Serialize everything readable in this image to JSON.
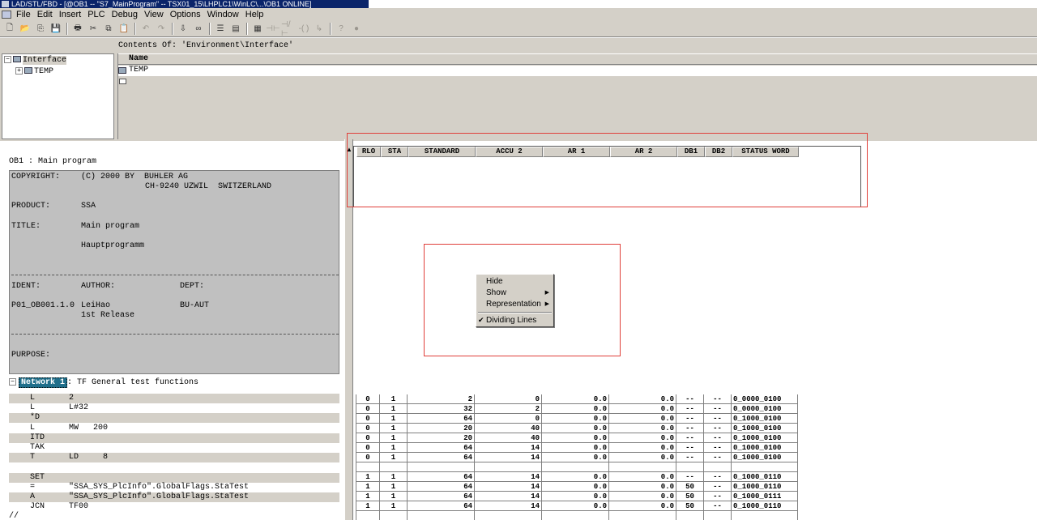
{
  "window": {
    "title": "LAD/STL/FBD  - [@OB1 -- \"S7_MainProgram\" -- TSX01_15\\LHPLC1\\WinLC\\...\\OB1  ONLINE]"
  },
  "menu": [
    "File",
    "Edit",
    "Insert",
    "PLC",
    "Debug",
    "View",
    "Options",
    "Window",
    "Help"
  ],
  "toolbar_icons": [
    "new-icon",
    "open-icon",
    "accessible-nodes-icon",
    "save-icon",
    "print-icon",
    "cut-icon",
    "copy-icon",
    "paste-icon",
    "undo-icon",
    "redo-icon",
    "load-icon",
    "monitor-icon",
    "overview-icon",
    "program-elements-icon",
    "details-icon",
    "contact-no-icon",
    "contact-nc-icon",
    "coil-icon",
    "branch-icon",
    "help-icon",
    "breakpoint-icon"
  ],
  "interface": {
    "contents_of": "Contents Of: 'Environment\\Interface'",
    "tree": [
      {
        "label": "Interface"
      },
      {
        "label": "TEMP"
      }
    ],
    "column_name": "Name",
    "rows": [
      "TEMP"
    ]
  },
  "block": {
    "title": "OB1 : Main program",
    "comment": {
      "copyright_label": "COPYRIGHT:",
      "copyright_line1": "(C) 2000 BY  BUHLER AG",
      "copyright_line2": "CH-9240 UZWIL  SWITZERLAND",
      "product_label": "PRODUCT:",
      "product": "SSA",
      "title_label": "TITLE:",
      "title1": "Main program",
      "title2": "Hauptprogramm",
      "ident_label": "IDENT:",
      "author_label": "AUTHOR:",
      "dept_label": "DEPT:",
      "ident": "P01_OB001.1.0",
      "author": "LeiHao",
      "release": "1st Release",
      "dept": "BU-AUT",
      "purpose_label": "PURPOSE:"
    },
    "network": {
      "badge": "Network 1",
      "title": ": TF General test functions"
    },
    "stl": [
      {
        "op": "L",
        "arg": "2"
      },
      {
        "op": "L",
        "arg": "L#32"
      },
      {
        "op": "*D",
        "arg": ""
      },
      {
        "op": "L",
        "arg": "MW   200"
      },
      {
        "op": "ITD",
        "arg": ""
      },
      {
        "op": "TAK",
        "arg": ""
      },
      {
        "op": "T",
        "arg": "LD     8"
      },
      {
        "op": "",
        "arg": ""
      },
      {
        "op": "SET",
        "arg": ""
      },
      {
        "op": "=",
        "arg": "\"SSA_SYS_PlcInfo\".GlobalFlags.StaTest"
      },
      {
        "op": "A",
        "arg": "\"SSA_SYS_PlcInfo\".GlobalFlags.StaTest"
      },
      {
        "op": "JCN",
        "arg": "TF00"
      },
      {
        "op": "//",
        "arg": ""
      }
    ]
  },
  "status": {
    "columns": [
      "RLO",
      "STA",
      "STANDARD",
      "ACCU 2",
      "AR 1",
      "AR 2",
      "DB1",
      "DB2",
      "STATUS WORD"
    ],
    "rows": [
      [
        "0",
        "1",
        "2",
        "0",
        "0.0",
        "0.0",
        "--",
        "--",
        "0_0000_0100"
      ],
      [
        "0",
        "1",
        "32",
        "2",
        "0.0",
        "0.0",
        "--",
        "--",
        "0_0000_0100"
      ],
      [
        "0",
        "1",
        "64",
        "0",
        "0.0",
        "0.0",
        "--",
        "--",
        "0_1000_0100"
      ],
      [
        "0",
        "1",
        "20",
        "40",
        "0.0",
        "0.0",
        "--",
        "--",
        "0_1000_0100"
      ],
      [
        "0",
        "1",
        "20",
        "40",
        "0.0",
        "0.0",
        "--",
        "--",
        "0_1000_0100"
      ],
      [
        "0",
        "1",
        "64",
        "14",
        "0.0",
        "0.0",
        "--",
        "--",
        "0_1000_0100"
      ],
      [
        "0",
        "1",
        "64",
        "14",
        "0.0",
        "0.0",
        "--",
        "--",
        "0_1000_0100"
      ],
      [
        "",
        "",
        "",
        "",
        "",
        "",
        "",
        "",
        ""
      ],
      [
        "1",
        "1",
        "64",
        "14",
        "0.0",
        "0.0",
        "--",
        "--",
        "0_1000_0110"
      ],
      [
        "1",
        "1",
        "64",
        "14",
        "0.0",
        "0.0",
        "50",
        "--",
        "0_1000_0110"
      ],
      [
        "1",
        "1",
        "64",
        "14",
        "0.0",
        "0.0",
        "50",
        "--",
        "0_1000_0111"
      ],
      [
        "1",
        "1",
        "64",
        "14",
        "0.0",
        "0.0",
        "50",
        "--",
        "0_1000_0110"
      ],
      [
        "",
        "",
        "",
        "",
        "",
        "",
        "",
        "",
        ""
      ]
    ]
  },
  "context_menu": {
    "items": [
      {
        "label": "Hide"
      },
      {
        "label": "Show"
      },
      {
        "label": "Representation"
      },
      {
        "label": "Dividing Lines"
      }
    ]
  },
  "colors": {
    "highlight": "#e0403a",
    "title_bar": "#0a246a",
    "network_badge": "#1f6f8b"
  }
}
